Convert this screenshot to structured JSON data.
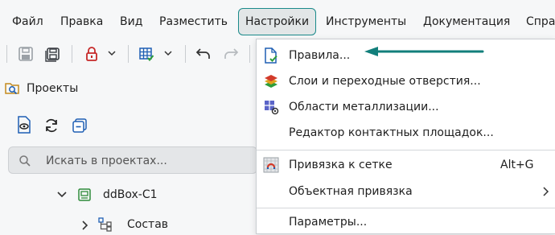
{
  "menubar": {
    "items": [
      {
        "label": "Файл"
      },
      {
        "label": "Правка"
      },
      {
        "label": "Вид"
      },
      {
        "label": "Разместить"
      },
      {
        "label": "Настройки"
      },
      {
        "label": "Инструменты"
      },
      {
        "label": "Документация"
      },
      {
        "label": "Спра"
      }
    ],
    "active_index": 4
  },
  "toolbar": {
    "icons": [
      "save-icon",
      "save-all-icon",
      "lock-icon",
      "grid-table-icon",
      "undo-icon",
      "redo-icon"
    ]
  },
  "projects_panel": {
    "title": "Проекты",
    "icons": [
      "document-view-icon",
      "refresh-icon",
      "collapse-icon"
    ],
    "search": {
      "placeholder": "Искать в проектах...",
      "value": ""
    },
    "tree": [
      {
        "label": "ddBox-C1",
        "expanded": true,
        "icon": "board-icon"
      },
      {
        "label": "Состав",
        "expanded": false,
        "icon": "structure-icon"
      }
    ]
  },
  "settings_menu": {
    "items": [
      {
        "label": "Правила...",
        "icon": "rules-icon",
        "highlighted": true
      },
      {
        "label": "Слои и переходные отверстия...",
        "icon": "layers-icon"
      },
      {
        "label": "Области металлизации...",
        "icon": "metallization-icon"
      },
      {
        "label": "Редактор контактных площадок...",
        "icon": ""
      },
      {
        "label": "Привязка к сетке",
        "icon": "grid-snap-icon",
        "shortcut": "Alt+G"
      },
      {
        "label": "Объектная привязка",
        "icon": "",
        "submenu": true
      },
      {
        "label": "Параметры...",
        "icon": ""
      }
    ]
  },
  "colors": {
    "accent": "#1a8a8a",
    "arrow": "#127f7b"
  }
}
